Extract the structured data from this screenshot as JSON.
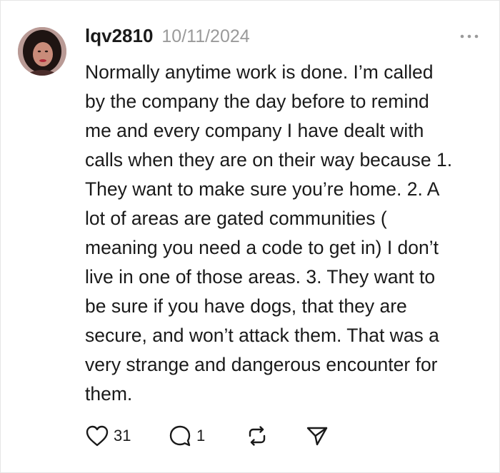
{
  "post": {
    "username": "lqv2810",
    "date": "10/11/2024",
    "body": "Normally anytime work is done. I’m called\nby the company the day before to remind\nme and every company I have dealt with\ncalls when they are on their way because 1.\nThey want to make sure you’re home. 2. A\nlot of areas are gated communities (\nmeaning you need a code to get in) I don’t\nlive in one of those areas. 3. They want to\nbe sure if you have dogs, that they are\nsecure, and won’t attack them. That was a\nvery strange and dangerous encounter for\nthem.",
    "avatar_icon": "user-avatar-photo",
    "more_icon": "ellipsis-icon"
  },
  "actions": {
    "like": {
      "icon": "heart-icon",
      "count": "31"
    },
    "reply": {
      "icon": "speech-bubble-icon",
      "count": "1"
    },
    "repost": {
      "icon": "repost-icon"
    },
    "share": {
      "icon": "send-icon"
    }
  },
  "colors": {
    "text": "#1a1a1a",
    "muted": "#9a9a9a",
    "background": "#ffffff"
  }
}
